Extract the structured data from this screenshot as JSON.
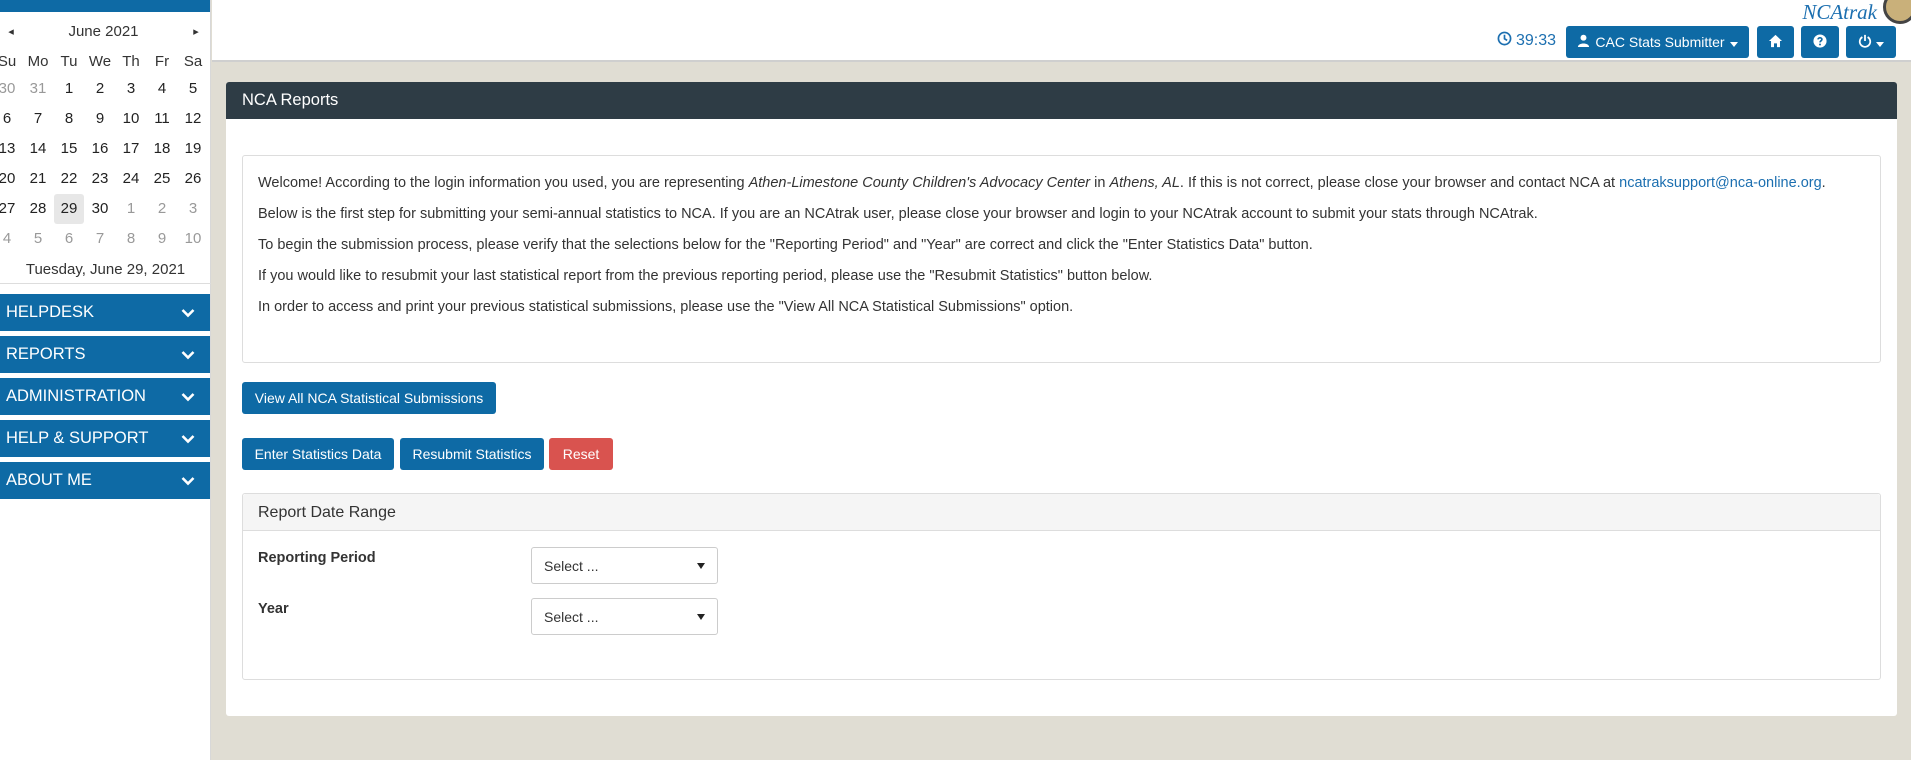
{
  "calendar": {
    "month_label": "June 2021",
    "prev_icon": "◂",
    "next_icon": "▸",
    "weekdays": [
      "Su",
      "Mo",
      "Tu",
      "We",
      "Th",
      "Fr",
      "Sa"
    ],
    "weeks": [
      [
        "30",
        "31",
        "1",
        "2",
        "3",
        "4",
        "5"
      ],
      [
        "6",
        "7",
        "8",
        "9",
        "10",
        "11",
        "12"
      ],
      [
        "13",
        "14",
        "15",
        "16",
        "17",
        "18",
        "19"
      ],
      [
        "20",
        "21",
        "22",
        "23",
        "24",
        "25",
        "26"
      ],
      [
        "27",
        "28",
        "29",
        "30",
        "1",
        "2",
        "3"
      ],
      [
        "4",
        "5",
        "6",
        "7",
        "8",
        "9",
        "10"
      ]
    ],
    "selected_date": "29",
    "footer": "Tuesday, June 29, 2021"
  },
  "menu": {
    "items": [
      "HELPDESK",
      "REPORTS",
      "ADMINISTRATION",
      "HELP & SUPPORT",
      "ABOUT ME"
    ]
  },
  "header": {
    "brand": "NCAtrak",
    "timer": "39:33",
    "user_button": "CAC Stats Submitter"
  },
  "panel": {
    "title": "NCA Reports",
    "welcome": {
      "p1_a": "Welcome! According to the login information you used, you are representing ",
      "p1_org": "Athen-Limestone County Children's Advocacy Center",
      "p1_b": " in ",
      "p1_city": "Athens, AL",
      "p1_c": ". If this is not correct, please close your browser and contact NCA at ",
      "p1_email": "ncatraksupport@nca-online.org",
      "p1_d": ".",
      "p2": "Below is the first step for submitting your semi-annual statistics to NCA. If you are an NCAtrak user, please close your browser and login to your NCAtrak account to submit your stats through NCAtrak.",
      "p3": "To begin the submission process, please verify that the selections below for the \"Reporting Period\" and \"Year\" are correct and click the \"Enter Statistics Data\" button.",
      "p4": "If you would like to resubmit your last statistical report from the previous reporting period, please use the \"Resubmit Statistics\" button below.",
      "p5": "In order to access and print your previous statistical submissions, please use the \"View All NCA Statistical Submissions\" option."
    },
    "buttons": {
      "view_all": "View All NCA Statistical Submissions",
      "enter": "Enter Statistics Data",
      "resubmit": "Resubmit Statistics",
      "reset": "Reset"
    },
    "range": {
      "title": "Report Date Range",
      "reporting_period_label": "Reporting Period",
      "reporting_period_value": "Select ...",
      "year_label": "Year",
      "year_value": "Select ..."
    }
  }
}
